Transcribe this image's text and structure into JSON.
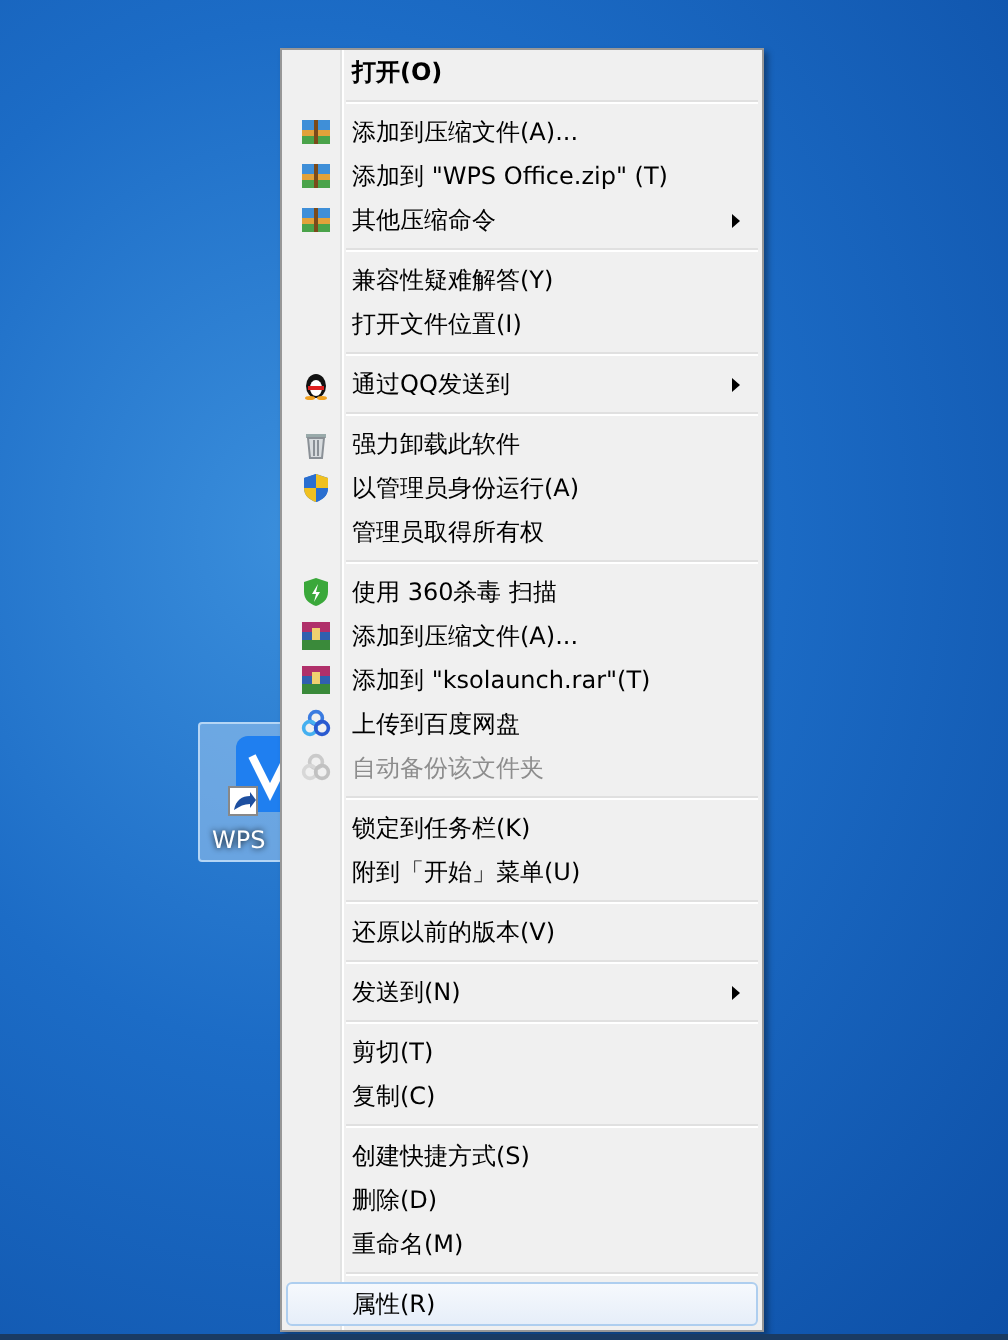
{
  "desktop_icon": {
    "label": "WPS",
    "selected": true
  },
  "context_menu": {
    "groups": [
      {
        "items": [
          {
            "label": "打开(O)",
            "bold": true,
            "kind": "plain",
            "submenu": false,
            "disabled": false,
            "selected": false
          }
        ]
      },
      {
        "items": [
          {
            "label": "添加到压缩文件(A)...",
            "bold": false,
            "kind": "archive",
            "submenu": false,
            "disabled": false,
            "selected": false
          },
          {
            "label": "添加到 \"WPS Office.zip\" (T)",
            "bold": false,
            "kind": "archive",
            "submenu": false,
            "disabled": false,
            "selected": false
          },
          {
            "label": "其他压缩命令",
            "bold": false,
            "kind": "archive",
            "submenu": true,
            "disabled": false,
            "selected": false
          }
        ]
      },
      {
        "items": [
          {
            "label": "兼容性疑难解答(Y)",
            "bold": false,
            "kind": "plain",
            "submenu": false,
            "disabled": false,
            "selected": false
          },
          {
            "label": "打开文件位置(I)",
            "bold": false,
            "kind": "plain",
            "submenu": false,
            "disabled": false,
            "selected": false
          }
        ]
      },
      {
        "items": [
          {
            "label": "通过QQ发送到",
            "bold": false,
            "kind": "penguin",
            "submenu": true,
            "disabled": false,
            "selected": false
          }
        ]
      },
      {
        "items": [
          {
            "label": "强力卸载此软件",
            "bold": false,
            "kind": "trash",
            "submenu": false,
            "disabled": false,
            "selected": false
          },
          {
            "label": "以管理员身份运行(A)",
            "bold": false,
            "kind": "uac-shield",
            "submenu": false,
            "disabled": false,
            "selected": false
          },
          {
            "label": "管理员取得所有权",
            "bold": false,
            "kind": "plain",
            "submenu": false,
            "disabled": false,
            "selected": false
          }
        ]
      },
      {
        "items": [
          {
            "label": "使用 360杀毒 扫描",
            "bold": false,
            "kind": "green-shield",
            "submenu": false,
            "disabled": false,
            "selected": false
          },
          {
            "label": "添加到压缩文件(A)...",
            "bold": false,
            "kind": "books",
            "submenu": false,
            "disabled": false,
            "selected": false
          },
          {
            "label": "添加到 \"ksolaunch.rar\"(T)",
            "bold": false,
            "kind": "books",
            "submenu": false,
            "disabled": false,
            "selected": false
          },
          {
            "label": "上传到百度网盘",
            "bold": false,
            "kind": "cloud",
            "submenu": false,
            "disabled": false,
            "selected": false
          },
          {
            "label": "自动备份该文件夹",
            "bold": false,
            "kind": "cloud",
            "submenu": false,
            "disabled": true,
            "selected": false
          }
        ]
      },
      {
        "items": [
          {
            "label": "锁定到任务栏(K)",
            "bold": false,
            "kind": "plain",
            "submenu": false,
            "disabled": false,
            "selected": false
          },
          {
            "label": "附到「开始」菜单(U)",
            "bold": false,
            "kind": "plain",
            "submenu": false,
            "disabled": false,
            "selected": false
          }
        ]
      },
      {
        "items": [
          {
            "label": "还原以前的版本(V)",
            "bold": false,
            "kind": "plain",
            "submenu": false,
            "disabled": false,
            "selected": false
          }
        ]
      },
      {
        "items": [
          {
            "label": "发送到(N)",
            "bold": false,
            "kind": "plain",
            "submenu": true,
            "disabled": false,
            "selected": false
          }
        ]
      },
      {
        "items": [
          {
            "label": "剪切(T)",
            "bold": false,
            "kind": "plain",
            "submenu": false,
            "disabled": false,
            "selected": false
          },
          {
            "label": "复制(C)",
            "bold": false,
            "kind": "plain",
            "submenu": false,
            "disabled": false,
            "selected": false
          }
        ]
      },
      {
        "items": [
          {
            "label": "创建快捷方式(S)",
            "bold": false,
            "kind": "plain",
            "submenu": false,
            "disabled": false,
            "selected": false
          },
          {
            "label": "删除(D)",
            "bold": false,
            "kind": "plain",
            "submenu": false,
            "disabled": false,
            "selected": false
          },
          {
            "label": "重命名(M)",
            "bold": false,
            "kind": "plain",
            "submenu": false,
            "disabled": false,
            "selected": false
          }
        ]
      },
      {
        "items": [
          {
            "label": "属性(R)",
            "bold": false,
            "kind": "plain",
            "submenu": false,
            "disabled": false,
            "selected": true
          }
        ]
      }
    ]
  }
}
